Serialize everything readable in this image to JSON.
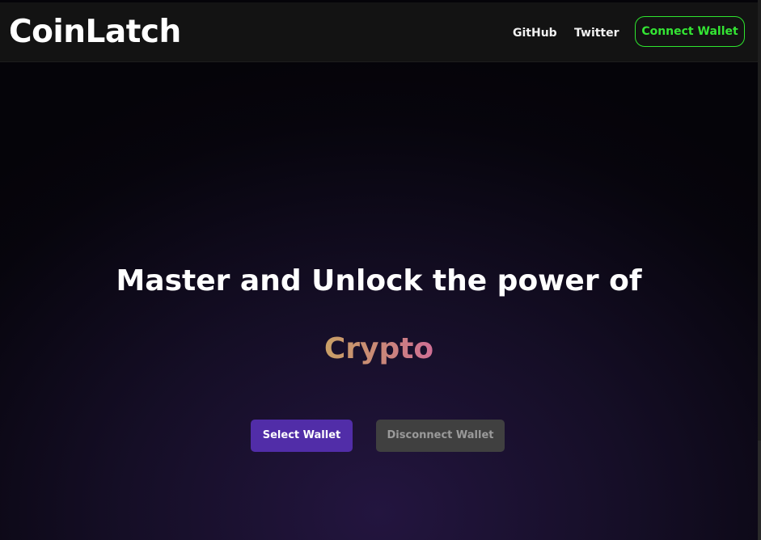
{
  "header": {
    "logo": "CoinLatch",
    "nav": {
      "github": "GitHub",
      "twitter": "Twitter"
    },
    "connect_label": "Connect Wallet"
  },
  "hero": {
    "title": "Master and Unlock the power of",
    "highlight": "Crypto",
    "select_label": "Select Wallet",
    "disconnect_label": "Disconnect Wallet"
  },
  "colors": {
    "accent_green": "#34e534",
    "select_purple": "#512da8",
    "disabled_gray": "#404040",
    "gradient_start": "#c9a066",
    "gradient_end": "#cf6f95"
  }
}
